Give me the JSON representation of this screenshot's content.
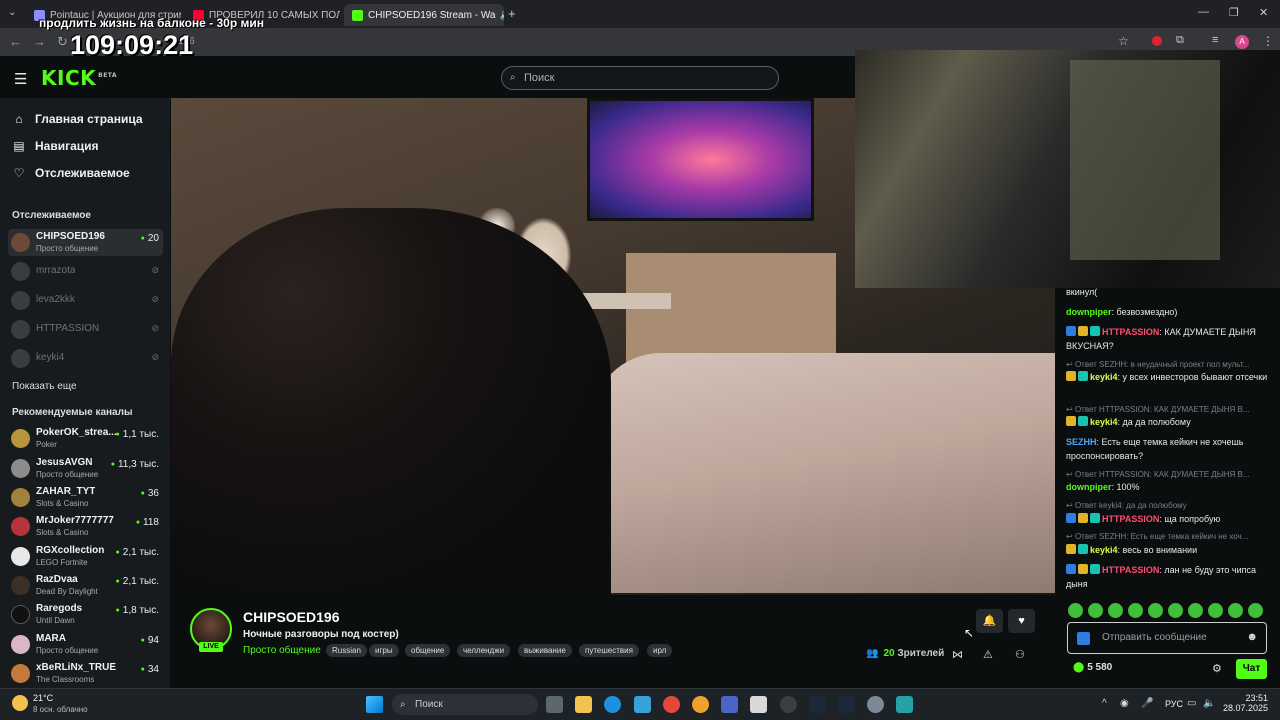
{
  "browser": {
    "tabs": [
      {
        "label": "Pointauc | Аукцион для стрим",
        "color": "#8a8dff"
      },
      {
        "label": "ПРОВЕРИЛ 10 САМЫХ ПОЛЕЗ",
        "color": "#ff0033"
      },
      {
        "label": "CHIPSOED196 Stream - Wa",
        "color": "#53fc18"
      }
    ],
    "url_fragment": "196",
    "profile_letter": "A"
  },
  "stream_overlay": {
    "title": "продлить жизнь на балконе - 30р мин",
    "timer": "109:09:21"
  },
  "kick": {
    "logo": "KICK",
    "logo_badge": "BETA",
    "search_placeholder": "Поиск",
    "colors": {
      "accent": "#53fc18",
      "background": "#0b0e0f",
      "sidebar": "#181b1d"
    }
  },
  "sidebar": {
    "nav": [
      {
        "label": "Главная страница",
        "icon": "home-icon"
      },
      {
        "label": "Навигация",
        "icon": "compass-icon"
      },
      {
        "label": "Отслеживаемое",
        "icon": "heart-icon"
      }
    ],
    "following_header": "Отслеживаемое",
    "following": [
      {
        "name": "CHIPSOED196",
        "category": "Просто общение",
        "viewers": "20",
        "live": true
      },
      {
        "name": "mrrazota",
        "live": false
      },
      {
        "name": "leva2kkk",
        "live": false
      },
      {
        "name": "HTTPASSION",
        "live": false
      },
      {
        "name": "keyki4",
        "live": false
      }
    ],
    "show_more": "Показать еще",
    "recommended_header": "Рекомендуемые каналы",
    "recommended": [
      {
        "name": "PokerOK_strea...",
        "category": "Poker",
        "viewers": "1,1 тыс."
      },
      {
        "name": "JesusAVGN",
        "category": "Просто общение",
        "viewers": "11,3 тыс."
      },
      {
        "name": "ZAHAR_TYT",
        "category": "Slots & Casino",
        "viewers": "36"
      },
      {
        "name": "MrJoker7777777",
        "category": "Slots & Casino",
        "viewers": "118"
      },
      {
        "name": "RGXcollection",
        "category": "LEGO Fortnite",
        "viewers": "2,1 тыс."
      },
      {
        "name": "RazDvaa",
        "category": "Dead By Daylight",
        "viewers": "2,1 тыс."
      },
      {
        "name": "Raregods",
        "category": "Until Dawn",
        "viewers": "1,8 тыс."
      },
      {
        "name": "MARA",
        "category": "Просто общение",
        "viewers": "94"
      },
      {
        "name": "xBeRLiNx_TRUE",
        "category": "The Classrooms",
        "viewers": "34"
      }
    ]
  },
  "stream": {
    "channel": "CHIPSOED196",
    "live_badge": "LIVE",
    "title": "Ночные разговоры под костер)",
    "category": "Просто общение",
    "tags": [
      "Russian",
      "игры",
      "общение",
      "челленджи",
      "выживание",
      "путешествия",
      "ирл"
    ],
    "viewers_count": "20",
    "viewers_label": "Зрителей"
  },
  "chat": {
    "messages": [
      {
        "kind": "text",
        "text": "вкинул("
      },
      {
        "kind": "msg",
        "user": "downpiper",
        "color": "#53fc18",
        "text": "безвозмездно)"
      },
      {
        "kind": "msg",
        "user": "HTTPASSION",
        "color": "#ff4d6d",
        "text": "КАК ДУМАЕТЕ ДЫНЯ ВКУСНАЯ?"
      },
      {
        "kind": "reply",
        "text": "Ответ SEZHH: в неудачный проект пол мульт..."
      },
      {
        "kind": "msg",
        "user": "keyki4",
        "color": "#d9ff4d",
        "text": "у всех инвесторов бывают отсечки"
      },
      {
        "kind": "reply",
        "text": "Ответ HTTPASSION: КАК ДУМАЕТЕ ДЫНЯ В..."
      },
      {
        "kind": "msg",
        "user": "keyki4",
        "color": "#d9ff4d",
        "text": "да да полюбому"
      },
      {
        "kind": "msg",
        "user": "SEZHH",
        "color": "#4da6ff",
        "text": "Есть еще темка кейкич не хочешь проспонсировать?"
      },
      {
        "kind": "reply",
        "text": "Ответ HTTPASSION: КАК ДУМАЕТЕ ДЫНЯ В..."
      },
      {
        "kind": "msg",
        "user": "downpiper",
        "color": "#53fc18",
        "text": "100%"
      },
      {
        "kind": "reply",
        "text": "Ответ keyki4: да да полюбому"
      },
      {
        "kind": "msg",
        "user": "HTTPASSION",
        "color": "#ff4d6d",
        "text": "ща попробую"
      },
      {
        "kind": "reply",
        "text": "Ответ SEZHH: Есть еще темка кейкич не хоч..."
      },
      {
        "kind": "msg",
        "user": "keyki4",
        "color": "#d9ff4d",
        "text": "весь во внимании"
      },
      {
        "kind": "msg",
        "user": "HTTPASSION",
        "color": "#ff4d6d",
        "text": "лан не буду это чипса дыня"
      }
    ],
    "input_placeholder": "Отправить сообщение",
    "points": "5 580",
    "send_label": "Чат"
  },
  "taskbar": {
    "temperature": "21°C",
    "weather": "8 осн. облачно",
    "search": "Поиск",
    "language": "РУС",
    "time": "23:51",
    "date": "28.07.2025"
  }
}
